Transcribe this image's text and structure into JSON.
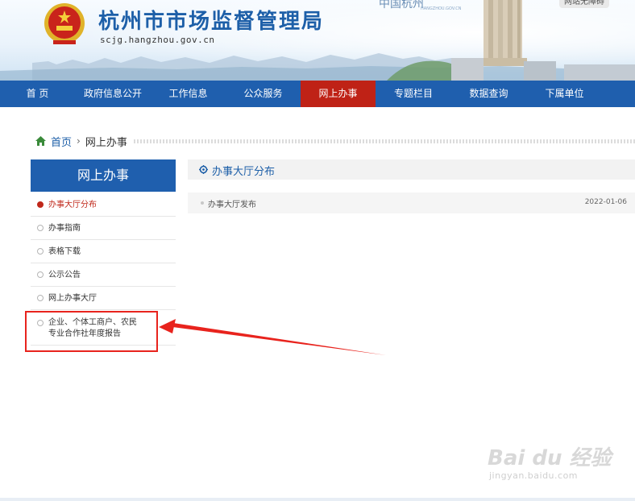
{
  "header": {
    "site_title": "杭州市市场监督管理局",
    "site_domain": "scjg.hangzhou.gov.cn",
    "hz_logo_text": "中国杭州",
    "hz_logo_en": "HANGZHOU.GOV.CN",
    "accessibility_label": "网站无障碍"
  },
  "nav": {
    "items": [
      {
        "label": "首 页"
      },
      {
        "label": "政府信息公开"
      },
      {
        "label": "工作信息"
      },
      {
        "label": "公众服务"
      },
      {
        "label": "网上办事"
      },
      {
        "label": "专题栏目"
      },
      {
        "label": "数据查询"
      },
      {
        "label": "下属单位"
      }
    ],
    "active_label": "网上办事"
  },
  "breadcrumb": {
    "home": "首页",
    "separator": "›",
    "current": "网上办事"
  },
  "sidebar": {
    "title": "网上办事",
    "items": [
      {
        "label": "办事大厅分布",
        "active": true
      },
      {
        "label": "办事指南"
      },
      {
        "label": "表格下载"
      },
      {
        "label": "公示公告"
      },
      {
        "label": "网上办事大厅"
      },
      {
        "label": "企业、个体工商户、农民专业合作社年度报告"
      }
    ]
  },
  "main": {
    "section_title": "办事大厅分布",
    "documents": [
      {
        "title": "办事大厅发布",
        "date": "2022-01-06"
      }
    ]
  },
  "watermark": {
    "logo": "Bai du 经验",
    "url": "jingyan.baidu.com"
  },
  "colors": {
    "nav_blue": "#1f5fae",
    "nav_active_red": "#bf2216",
    "title_blue": "#1d5fa8",
    "annotation_red": "#e8231d"
  },
  "icons": {
    "home": "home-icon",
    "section": "gear-icon",
    "emblem": "national-emblem-icon"
  }
}
